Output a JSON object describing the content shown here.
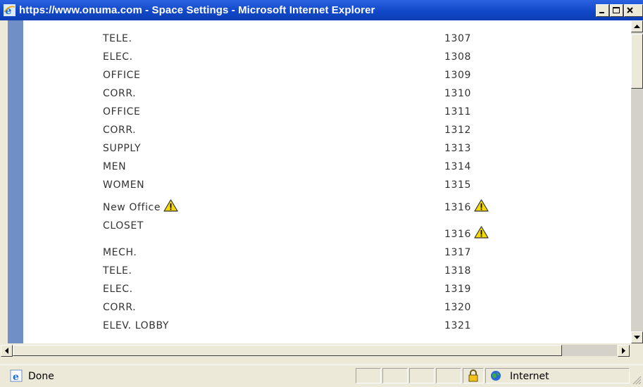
{
  "window": {
    "title": "https://www.onuma.com - Space Settings - Microsoft Internet Explorer"
  },
  "spaces": [
    {
      "name": "TELE.",
      "number": "1307",
      "name_warning": false,
      "number_warning": false
    },
    {
      "name": "ELEC.",
      "number": "1308",
      "name_warning": false,
      "number_warning": false
    },
    {
      "name": "OFFICE",
      "number": "1309",
      "name_warning": false,
      "number_warning": false
    },
    {
      "name": "CORR.",
      "number": "1310",
      "name_warning": false,
      "number_warning": false
    },
    {
      "name": "OFFICE",
      "number": "1311",
      "name_warning": false,
      "number_warning": false
    },
    {
      "name": "CORR.",
      "number": "1312",
      "name_warning": false,
      "number_warning": false
    },
    {
      "name": "SUPPLY",
      "number": "1313",
      "name_warning": false,
      "number_warning": false
    },
    {
      "name": "MEN",
      "number": "1314",
      "name_warning": false,
      "number_warning": false
    },
    {
      "name": "WOMEN",
      "number": "1315",
      "name_warning": false,
      "number_warning": false
    },
    {
      "name": "New Office",
      "number": "1316",
      "name_warning": true,
      "number_warning": true
    },
    {
      "name": "CLOSET",
      "number": "1316",
      "name_warning": false,
      "number_warning": true
    },
    {
      "name": "MECH.",
      "number": "1317",
      "name_warning": false,
      "number_warning": false
    },
    {
      "name": "TELE.",
      "number": "1318",
      "name_warning": false,
      "number_warning": false
    },
    {
      "name": "ELEC.",
      "number": "1319",
      "name_warning": false,
      "number_warning": false
    },
    {
      "name": "CORR.",
      "number": "1320",
      "name_warning": false,
      "number_warning": false
    },
    {
      "name": "ELEV. LOBBY",
      "number": "1321",
      "name_warning": false,
      "number_warning": false
    }
  ],
  "statusbar": {
    "status": "Done",
    "zone": "Internet",
    "icons": [
      "ie-page-icon",
      "lock-icon",
      "globe-icon"
    ]
  },
  "colors": {
    "titlebar": "#0d3fb5",
    "warning": "#f5d800"
  }
}
